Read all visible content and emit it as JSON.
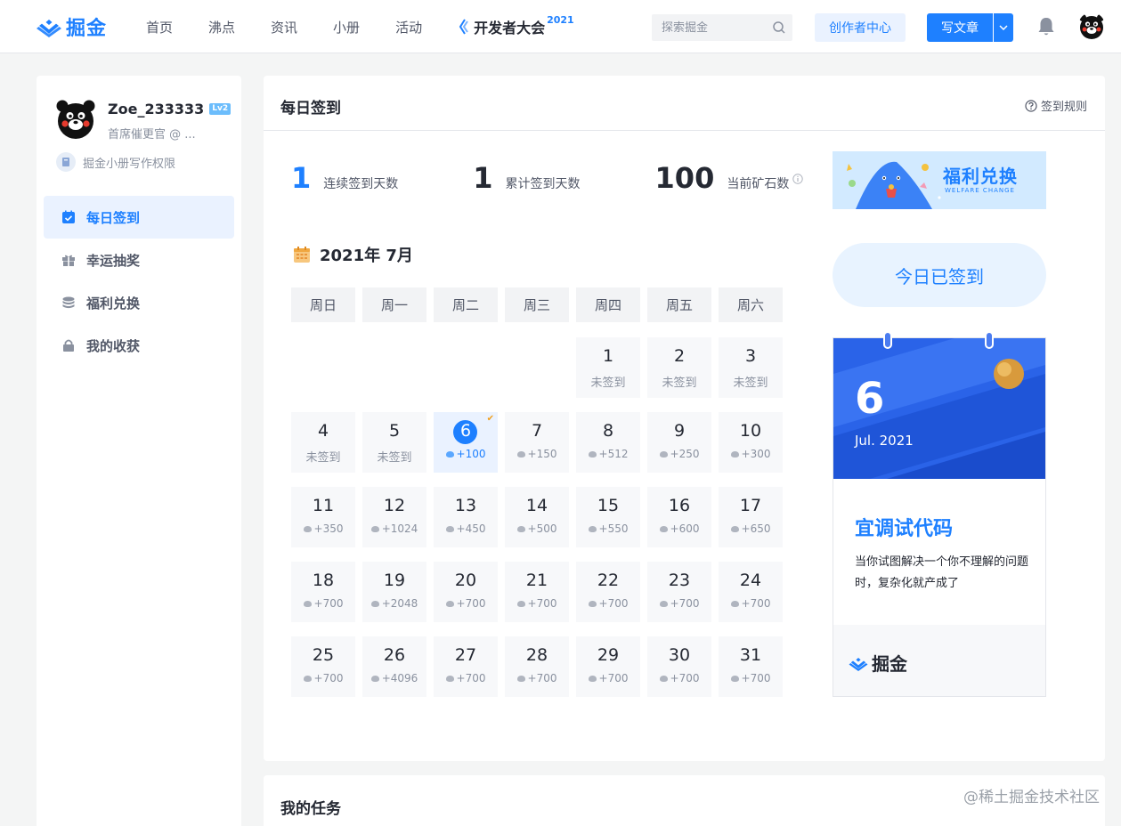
{
  "header": {
    "logo_text": "掘金",
    "nav": [
      "首页",
      "沸点",
      "资讯",
      "小册",
      "活动"
    ],
    "special_nav": "开发者大会",
    "special_nav_year": "2021",
    "search_placeholder": "探索掘金",
    "creator_center": "创作者中心",
    "write_article": "写文章"
  },
  "sidebar": {
    "username": "Zoe_233333",
    "level": "Lv2",
    "user_title": "首席催更官 @ ...",
    "permission": "掘金小册写作权限",
    "menu": [
      {
        "label": "每日签到",
        "icon": "calendar-check-icon",
        "active": true
      },
      {
        "label": "幸运抽奖",
        "icon": "gift-icon",
        "active": false
      },
      {
        "label": "福利兑换",
        "icon": "coins-icon",
        "active": false
      },
      {
        "label": "我的收获",
        "icon": "lock-icon",
        "active": false
      }
    ]
  },
  "main": {
    "title": "每日签到",
    "rules": "签到规则",
    "stats": [
      {
        "value": "1",
        "label": "连续签到天数"
      },
      {
        "value": "1",
        "label": "累计签到天数"
      },
      {
        "value": "100",
        "label": "当前矿石数"
      }
    ],
    "month_label": "2021年 7月",
    "weekdays": [
      "周日",
      "周一",
      "周二",
      "周三",
      "周四",
      "周五",
      "周六"
    ],
    "first_weekday_index": 4,
    "days": [
      {
        "day": "1",
        "status": "未签到"
      },
      {
        "day": "2",
        "status": "未签到"
      },
      {
        "day": "3",
        "status": "未签到"
      },
      {
        "day": "4",
        "status": "未签到"
      },
      {
        "day": "5",
        "status": "未签到"
      },
      {
        "day": "6",
        "status": "+100",
        "today": true
      },
      {
        "day": "7",
        "status": "+150"
      },
      {
        "day": "8",
        "status": "+512"
      },
      {
        "day": "9",
        "status": "+250"
      },
      {
        "day": "10",
        "status": "+300"
      },
      {
        "day": "11",
        "status": "+350"
      },
      {
        "day": "12",
        "status": "+1024"
      },
      {
        "day": "13",
        "status": "+450"
      },
      {
        "day": "14",
        "status": "+500"
      },
      {
        "day": "15",
        "status": "+550"
      },
      {
        "day": "16",
        "status": "+600"
      },
      {
        "day": "17",
        "status": "+650"
      },
      {
        "day": "18",
        "status": "+700"
      },
      {
        "day": "19",
        "status": "+2048"
      },
      {
        "day": "20",
        "status": "+700"
      },
      {
        "day": "21",
        "status": "+700"
      },
      {
        "day": "22",
        "status": "+700"
      },
      {
        "day": "23",
        "status": "+700"
      },
      {
        "day": "24",
        "status": "+700"
      },
      {
        "day": "25",
        "status": "+700"
      },
      {
        "day": "26",
        "status": "+4096"
      },
      {
        "day": "27",
        "status": "+700"
      },
      {
        "day": "28",
        "status": "+700"
      },
      {
        "day": "29",
        "status": "+700"
      },
      {
        "day": "30",
        "status": "+700"
      },
      {
        "day": "31",
        "status": "+700"
      }
    ]
  },
  "right": {
    "banner_text": "福利兑换",
    "banner_sub": "WELFARE CHANGE",
    "signed_button": "今日已签到",
    "card_day": "6",
    "card_month": "Jul. 2021",
    "card_title": "宜调试代码",
    "card_quote": "当你试图解决一个你不理解的问题时，复杂化就产成了",
    "card_logo": "掘金"
  },
  "tasks": {
    "title": "我的任务"
  },
  "watermark": "@稀土掘金技术社区",
  "colors": {
    "accent": "#1e80ff",
    "accent_light": "#eaf2ff",
    "page_bg": "#f4f5f5"
  }
}
